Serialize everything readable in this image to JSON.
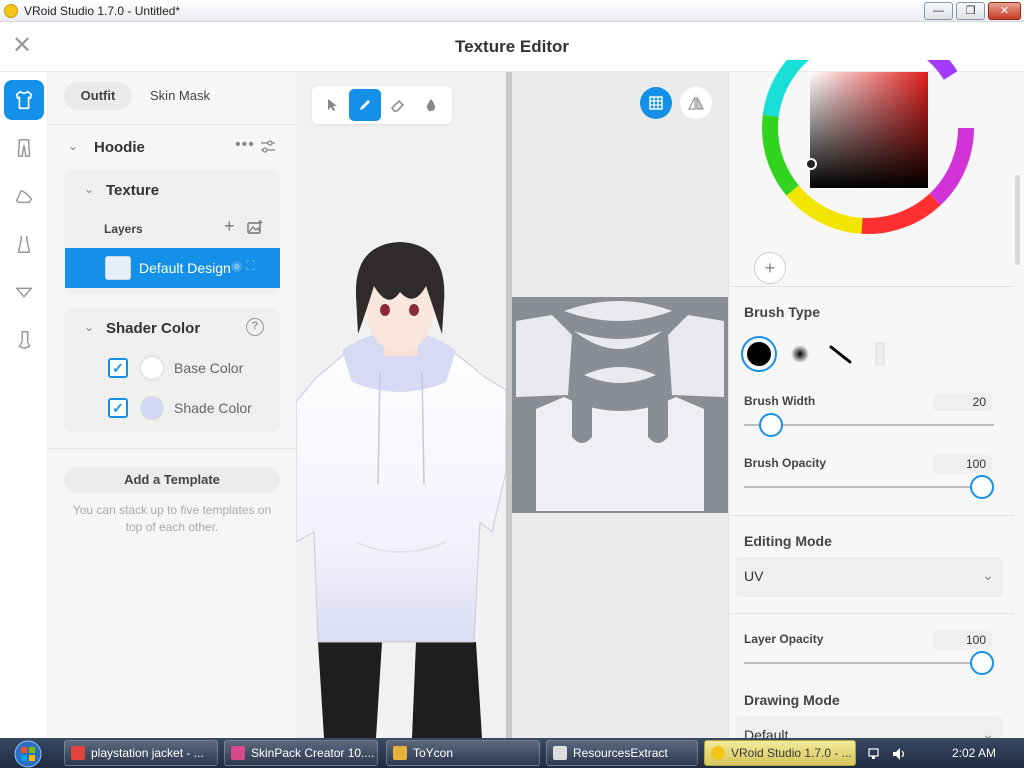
{
  "window": {
    "title": "VRoid Studio 1.7.0 - Untitled*",
    "min_glyph": "—",
    "max_glyph": "❐",
    "close_glyph": "✕"
  },
  "header": {
    "close_glyph": "✕",
    "title": "Texture Editor"
  },
  "rail": {
    "items": [
      {
        "icon": "shirt-icon",
        "active": true
      },
      {
        "icon": "pants-icon",
        "active": false
      },
      {
        "icon": "shoe-icon",
        "active": false
      },
      {
        "icon": "dress-icon",
        "active": false
      },
      {
        "icon": "accessory-icon",
        "active": false
      },
      {
        "icon": "sock-icon",
        "active": false
      }
    ]
  },
  "left_panel": {
    "tabs": {
      "outfit": "Outfit",
      "skin_mask": "Skin Mask"
    },
    "item_title": "Hoodie",
    "more_glyph": "•••",
    "texture_title": "Texture",
    "layers_label": "Layers",
    "add_glyph": "+",
    "layer": {
      "name": "Default Design"
    },
    "shader_title": "Shader Color",
    "help_glyph": "?",
    "check_glyph": "✓",
    "colors": [
      {
        "label": "Base Color",
        "swatch": "#ffffff",
        "checked": true
      },
      {
        "label": "Shade Color",
        "swatch": "#d4d6f6",
        "checked": true
      }
    ],
    "template_button": "Add a Template",
    "template_note": "You can stack up to five templates on top of each other."
  },
  "right_panel": {
    "add_color_glyph": "+",
    "brush_type_title": "Brush Type",
    "brush_width": {
      "label": "Brush Width",
      "value": "20",
      "fraction": 0.1
    },
    "brush_opacity": {
      "label": "Brush Opacity",
      "value": "100",
      "fraction": 1.0
    },
    "editing_mode": {
      "label": "Editing Mode",
      "value": "UV",
      "chevron": "⌄"
    },
    "layer_opacity": {
      "label": "Layer Opacity",
      "value": "100",
      "fraction": 1.0
    },
    "drawing_mode": {
      "label": "Drawing Mode",
      "value": "Default",
      "chevron": "⌄"
    }
  },
  "accent_color": "#1590e8",
  "taskbar": {
    "items": [
      {
        "label": "playstation jacket - ...",
        "icon": "chrome-icon",
        "color": "#e0443a"
      },
      {
        "label": "SkinPack Creator 10....",
        "icon": "skinpack-icon",
        "color": "#d84a8a"
      },
      {
        "label": "ToYcon",
        "icon": "toycon-icon",
        "color": "#e7b33a"
      },
      {
        "label": "ResourcesExtract",
        "icon": "resources-icon",
        "color": "#dddddd"
      },
      {
        "label": "VRoid Studio 1.7.0 - ...",
        "icon": "vroid-icon",
        "color": "#f5c518",
        "active": true
      }
    ],
    "clock": "2:02 AM"
  }
}
